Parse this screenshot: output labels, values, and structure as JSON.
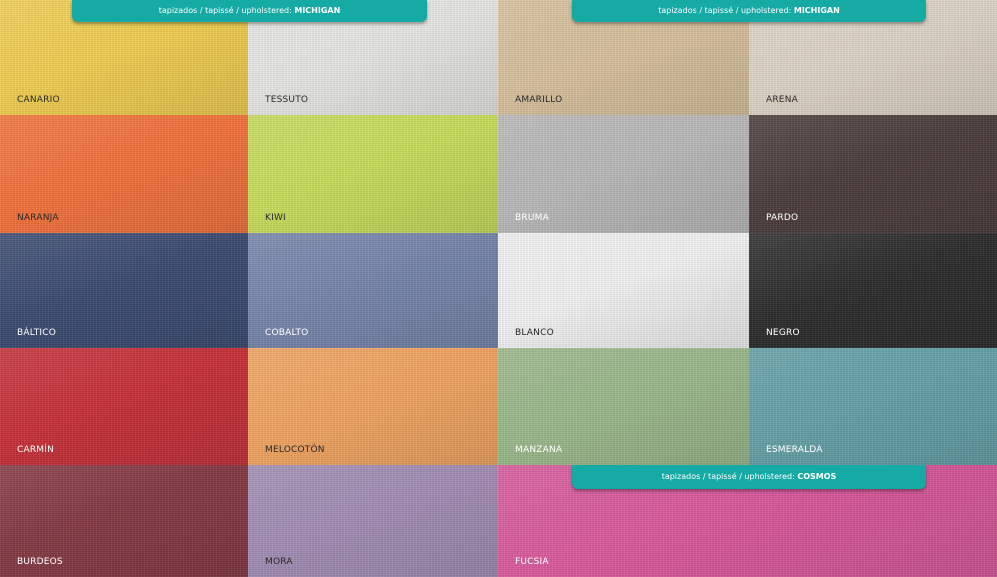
{
  "tabs": [
    {
      "prefix": "tapizados / tapissé / upholstered: ",
      "name": "MICHIGAN"
    },
    {
      "prefix": "tapizados / tapissé / upholstered: ",
      "name": "MICHIGAN"
    },
    {
      "prefix": "tapizados / tapissé / upholstered: ",
      "name": "COSMOS"
    }
  ],
  "swatches": [
    {
      "label": "CANARIO",
      "color": "#f0cd4f"
    },
    {
      "label": "TESSUTO",
      "color": "#e6e6e4"
    },
    {
      "label": "AMARILLO",
      "color": "#d6c09b"
    },
    {
      "label": "ARENA",
      "color": "#ddd3c6"
    },
    {
      "label": "NARANJA",
      "color": "#f2713a"
    },
    {
      "label": "KIWI",
      "color": "#c7dc5a"
    },
    {
      "label": "BRUMA",
      "color": "#b8b8b8"
    },
    {
      "label": "PARDO",
      "color": "#4a3c3a"
    },
    {
      "label": "BÁLTICO",
      "color": "#3a4a70"
    },
    {
      "label": "COBALTO",
      "color": "#7584aa"
    },
    {
      "label": "BLANCO",
      "color": "#f1f1f1"
    },
    {
      "label": "NEGRO",
      "color": "#2b2b2b"
    },
    {
      "label": "CARMÍN",
      "color": "#c62f37"
    },
    {
      "label": "MELOCOTÓN",
      "color": "#f0a35f"
    },
    {
      "label": "MANZANA",
      "color": "#9ab78a"
    },
    {
      "label": "ESMERALDA",
      "color": "#63a0a6"
    },
    {
      "label": "BURDEOS",
      "color": "#833843"
    },
    {
      "label": "MORA",
      "color": "#a18cb3"
    },
    {
      "label": "FUCSIA",
      "color": "#d8579a"
    }
  ]
}
